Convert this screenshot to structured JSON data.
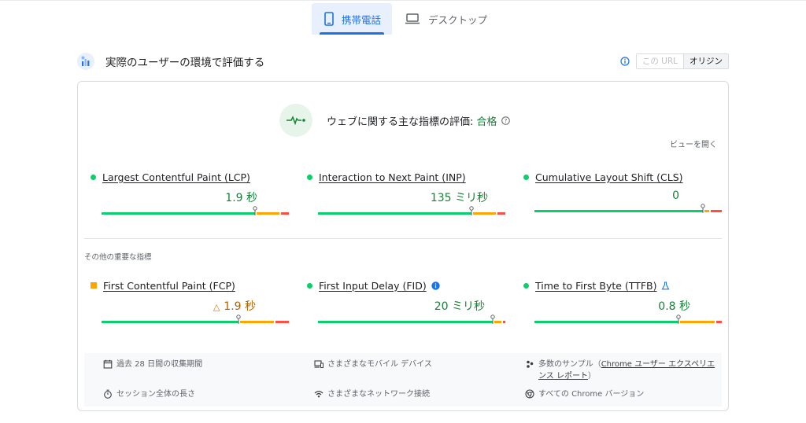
{
  "tabs": [
    {
      "label": "携帯電話",
      "icon": "smartphone-icon",
      "active": true
    },
    {
      "label": "デスクトップ",
      "icon": "laptop-icon",
      "active": false
    }
  ],
  "section": {
    "title": "実際のユーザーの環境で評価する",
    "icon": "field-data-icon",
    "toggle": {
      "url_label": "この URL",
      "origin_label": "オリジン",
      "selected": "origin"
    }
  },
  "assessment": {
    "label": "ウェブに関する主な指標の評価:",
    "result": "合格",
    "expand_label": "ビューを開く"
  },
  "core_metrics": [
    {
      "name": "Largest Contentful Paint (LCP)",
      "value": "1.9 秒",
      "status": "good",
      "distribution": {
        "good": 0.75,
        "ni": 0.11,
        "poor": 0.04
      }
    },
    {
      "name": "Interaction to Next Paint (INP)",
      "value": "135 ミリ秒",
      "status": "good",
      "distribution": {
        "good": 0.75,
        "ni": 0.11,
        "poor": 0.04
      }
    },
    {
      "name": "Cumulative Layout Shift (CLS)",
      "value": "0",
      "status": "good",
      "distribution": {
        "good": 0.75,
        "ni": 0.02,
        "poor": 0.05
      }
    }
  ],
  "other_label": "その他の重要な指標",
  "other_metrics": [
    {
      "name": "First Contentful Paint (FCP)",
      "value": "1.9 秒",
      "status": "needs-improvement",
      "distribution": {
        "good": 0.72,
        "ni": 0.18,
        "poor": 0.07
      }
    },
    {
      "name": "First Input Delay (FID)",
      "value": "20 ミリ秒",
      "status": "good",
      "distribution": {
        "good": 0.75,
        "ni": 0.03,
        "poor": 0.01
      }
    },
    {
      "name": "Time to First Byte (TTFB)",
      "value": "0.8 秒",
      "status": "good",
      "distribution": {
        "good": 0.75,
        "ni": 0.18,
        "poor": 0.03
      }
    }
  ],
  "footer": {
    "period": "過去 28 日間の収集期間",
    "devices": "さまざまなモバイル デバイス",
    "samples_prefix": "多数のサンプル（",
    "samples_link": "Chrome ユーザー エクスペリエンス レポート",
    "samples_suffix": "）",
    "session": "セッション全体の長さ",
    "network": "さまざまなネットワーク接続",
    "chrome": "すべての Chrome バージョン"
  },
  "colors": {
    "good": "#0cce6b",
    "ni": "#ffa400",
    "poor": "#ff4e42",
    "accent": "#1a73e8",
    "pass_text": "#188038"
  }
}
